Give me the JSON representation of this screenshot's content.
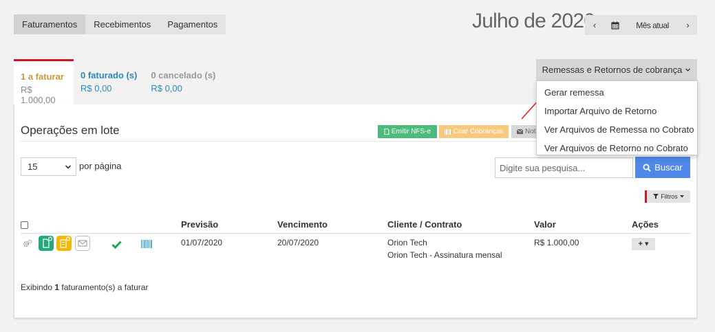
{
  "top_tabs": [
    {
      "label": "Faturamentos",
      "active": true
    },
    {
      "label": "Recebimentos",
      "active": false
    },
    {
      "label": "Pagamentos",
      "active": false
    }
  ],
  "month": {
    "title": "Julho de 2020",
    "current_label": "Mês atual",
    "prev_glyph": "‹",
    "next_glyph": "›"
  },
  "status_tabs": [
    {
      "title": "1 a faturar",
      "value": "R$ 1.000,00"
    },
    {
      "title": "0 faturado (s)",
      "value": "R$ 0,00"
    },
    {
      "title": "0 cancelado (s)",
      "value": "R$ 0,00"
    }
  ],
  "remessas": {
    "button_label": "Remessas e Retornos de cobrança",
    "items": [
      "Gerar remessa",
      "Importar Arquivo de Retorno",
      "Ver Arquivos de Remessa no Cobrato",
      "Ver Arquivos de Retorno no Cobrato"
    ]
  },
  "operations": {
    "title": "Operações em lote",
    "emit_label": "Emitir NFS-e",
    "create_label": "Criar Cobranças",
    "notify_label": "Not"
  },
  "per_page": {
    "value": "15",
    "label": "por página"
  },
  "search": {
    "placeholder": "Digite sua pesquisa...",
    "button_label": "Buscar"
  },
  "filters_label": "Filtros",
  "table": {
    "headers": {
      "previsao": "Previsão",
      "vencimento": "Vencimento",
      "cliente": "Cliente / Contrato",
      "valor": "Valor",
      "acoes": "Ações"
    },
    "rows": [
      {
        "previsao": "01/07/2020",
        "vencimento": "20/07/2020",
        "cliente": "Orion Tech",
        "contrato": "Orion Tech - Assinatura mensal",
        "valor": "R$ 1.000,00",
        "acoes": "+ ▾"
      }
    ]
  },
  "footer": {
    "prefix": "Exibindo ",
    "count": "1",
    "suffix": " faturamento(s) a faturar"
  },
  "colors": {
    "accent_red": "#d4141f",
    "primary_blue": "#4f88e8",
    "success_green": "#4cbb7b",
    "warning_orange": "#f6c97e"
  }
}
